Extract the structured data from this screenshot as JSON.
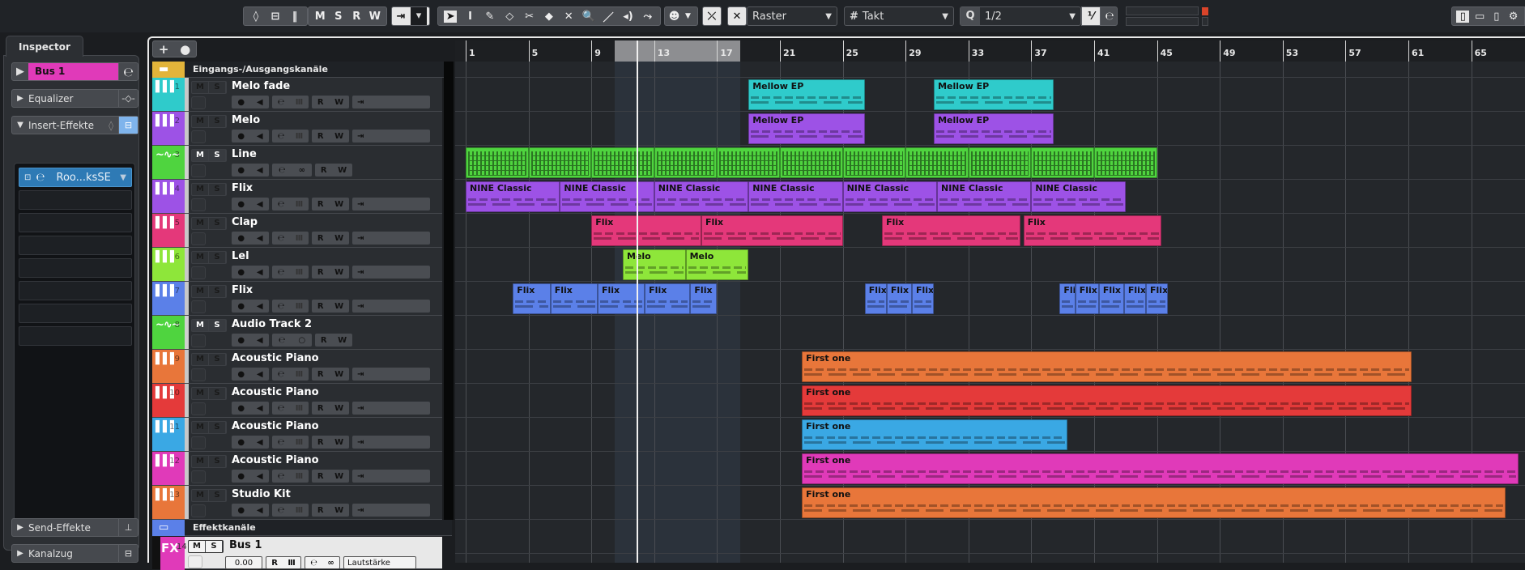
{
  "toolbar": {
    "group1": [
      "◊",
      "⊟",
      "‖"
    ],
    "msrw": [
      "M",
      "S",
      "R",
      "W"
    ],
    "auto_icon": "⇥",
    "tools": [
      "➤",
      "I",
      "✎",
      "◇",
      "✂",
      "◆",
      "✕",
      "🔍",
      "／",
      "◂)",
      "⤳"
    ],
    "snap_type": "Raster",
    "grid": "Takt",
    "grid_icon": "#",
    "quantize_label": "Q",
    "quantize_value": "1/2",
    "q_extra": [
      "⅟",
      "℮"
    ],
    "meter_clip_color": "#d9442a",
    "window_layout": [
      "▯",
      "▭",
      "▯",
      "⚙"
    ]
  },
  "inspector": {
    "tab": "Inspector",
    "channel": "Bus 1",
    "channel_color": "#e03ab9",
    "equalizer": "Equalizer",
    "inserts": "Insert-Effekte",
    "insert_slot": "Roo...ksSE",
    "sends": "Send-Effekte",
    "strip": "Kanalzug"
  },
  "tracklist": {
    "folder_io": "Eingangs-/Ausgangskanäle",
    "folder_fx": "Effektkanäle",
    "buttons": {
      "mute": "M",
      "solo": "S",
      "read": "R",
      "write": "W"
    },
    "tracks": [
      {
        "num": "1",
        "name": "Melo fade",
        "type": "midi",
        "color": "#2fcbcb",
        "clips": [
          {
            "label": "Mellow EP",
            "start": 19,
            "end": 26.4
          },
          {
            "label": "Mellow EP",
            "start": 30.8,
            "end": 38.4
          }
        ]
      },
      {
        "num": "2",
        "name": "Melo",
        "type": "midi",
        "color": "#9d52e6",
        "clips": [
          {
            "label": "Mellow EP",
            "start": 19,
            "end": 26.4
          },
          {
            "label": "Mellow EP",
            "start": 30.8,
            "end": 38.4
          }
        ]
      },
      {
        "num": "3",
        "name": "Line",
        "type": "audio",
        "color": "#4fd43f",
        "clips": [
          {
            "label": "",
            "start": 1,
            "end": 5
          },
          {
            "label": "",
            "start": 5,
            "end": 9
          },
          {
            "label": "",
            "start": 9,
            "end": 13
          },
          {
            "label": "",
            "start": 13,
            "end": 17
          },
          {
            "label": "",
            "start": 17,
            "end": 21
          },
          {
            "label": "",
            "start": 21,
            "end": 25
          },
          {
            "label": "",
            "start": 25,
            "end": 29
          },
          {
            "label": "",
            "start": 29,
            "end": 33
          },
          {
            "label": "",
            "start": 33,
            "end": 37
          },
          {
            "label": "",
            "start": 37,
            "end": 41
          },
          {
            "label": "",
            "start": 41,
            "end": 45
          }
        ]
      },
      {
        "num": "4",
        "name": "Flix",
        "type": "midi",
        "color": "#9d52e6",
        "clips": [
          {
            "label": "NINE Classic",
            "start": 1,
            "end": 7
          },
          {
            "label": "NINE Classic",
            "start": 7,
            "end": 13
          },
          {
            "label": "NINE Classic",
            "start": 13,
            "end": 19
          },
          {
            "label": "NINE Classic",
            "start": 19,
            "end": 25
          },
          {
            "label": "NINE Classic",
            "start": 25,
            "end": 31
          },
          {
            "label": "NINE Classic",
            "start": 31,
            "end": 37
          },
          {
            "label": "NINE Classic",
            "start": 37,
            "end": 43
          }
        ]
      },
      {
        "num": "5",
        "name": "Clap",
        "type": "midi",
        "color": "#e4387a",
        "clips": [
          {
            "label": "Flix",
            "start": 9,
            "end": 16
          },
          {
            "label": "Flix",
            "start": 16,
            "end": 25
          },
          {
            "label": "Flix",
            "start": 27.5,
            "end": 36.3
          },
          {
            "label": "Flix",
            "start": 36.5,
            "end": 45.3
          }
        ]
      },
      {
        "num": "6",
        "name": "Lel",
        "type": "midi",
        "color": "#8ee63a",
        "clips": [
          {
            "label": "Melo",
            "start": 11,
            "end": 15
          },
          {
            "label": "Melo",
            "start": 15,
            "end": 19
          }
        ]
      },
      {
        "num": "7",
        "name": "Flix",
        "type": "midi",
        "color": "#5b80e8",
        "clips": [
          {
            "label": "Flix",
            "start": 4,
            "end": 6.4
          },
          {
            "label": "Flix",
            "start": 6.4,
            "end": 9.4
          },
          {
            "label": "Flix",
            "start": 9.4,
            "end": 12.4
          },
          {
            "label": "Flix",
            "start": 12.4,
            "end": 15.3
          },
          {
            "label": "Flix",
            "start": 15.3,
            "end": 17
          },
          {
            "label": "Flix",
            "start": 26.4,
            "end": 27.8
          },
          {
            "label": "Flix",
            "start": 27.8,
            "end": 29.4
          },
          {
            "label": "Flix",
            "start": 29.4,
            "end": 30.8
          },
          {
            "label": "Flix",
            "start": 38.8,
            "end": 39.8
          },
          {
            "label": "Flix",
            "start": 39.8,
            "end": 41.3
          },
          {
            "label": "Flix",
            "start": 41.3,
            "end": 42.9
          },
          {
            "label": "Flix",
            "start": 42.9,
            "end": 44.3
          },
          {
            "label": "Flix",
            "start": 44.3,
            "end": 45.7
          }
        ]
      },
      {
        "num": "8",
        "name": "Audio Track 2",
        "type": "audio",
        "color": "#4fd43f",
        "clips": []
      },
      {
        "num": "9",
        "name": "Acoustic Piano",
        "type": "midi",
        "color": "#e8763a",
        "clips": [
          {
            "label": "First one",
            "start": 22.4,
            "end": 61.2
          }
        ]
      },
      {
        "num": "10",
        "name": "Acoustic Piano",
        "type": "midi",
        "color": "#e43a3a",
        "clips": [
          {
            "label": "First one",
            "start": 22.4,
            "end": 61.2
          }
        ]
      },
      {
        "num": "11",
        "name": "Acoustic Piano",
        "type": "midi",
        "color": "#3aa8e4",
        "clips": [
          {
            "label": "First one",
            "start": 22.4,
            "end": 39.3
          }
        ]
      },
      {
        "num": "12",
        "name": "Acoustic Piano",
        "type": "midi",
        "color": "#e03ab9",
        "clips": [
          {
            "label": "First one",
            "start": 22.4,
            "end": 68
          }
        ]
      },
      {
        "num": "13",
        "name": "Studio Kit",
        "type": "midi",
        "color": "#e8763a",
        "clips": [
          {
            "label": "First one",
            "start": 22.4,
            "end": 67.2
          }
        ]
      }
    ],
    "fx_track": {
      "badge": "FX",
      "num": "14",
      "name": "Bus 1",
      "color": "#e03ab9",
      "volume": "0.00",
      "param": "Lautstärke"
    }
  },
  "ruler": {
    "bars": [
      "1",
      "5",
      "9",
      "13",
      "17",
      "21",
      "25",
      "29",
      "33",
      "37",
      "41",
      "45",
      "49",
      "53",
      "57",
      "61",
      "65"
    ],
    "loop_start": 10.5,
    "loop_end": 18.5,
    "playhead": 11.9
  }
}
